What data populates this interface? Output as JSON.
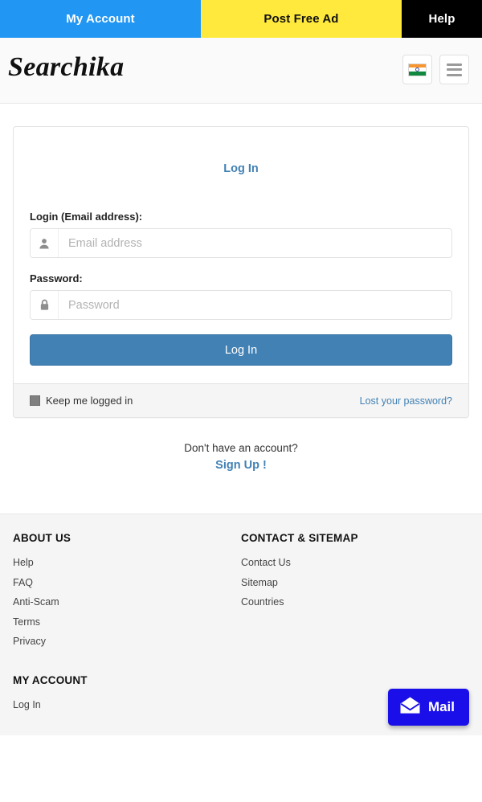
{
  "topnav": {
    "items": [
      {
        "label": "My Account",
        "bg": "#2196f3",
        "color": "#ffffff"
      },
      {
        "label": "Post Free Ad",
        "bg": "#ffe93d",
        "color": "#111111"
      },
      {
        "label": "Help",
        "bg": "#000000",
        "color": "#ffffff"
      }
    ]
  },
  "header": {
    "brand": "Searchika",
    "flag_icon": "india-flag-icon",
    "menu_icon": "hamburger-menu-icon"
  },
  "login_panel": {
    "heading": "Log In",
    "email": {
      "label": "Login (Email address):",
      "placeholder": "Email address",
      "value": "",
      "icon": "user-icon"
    },
    "password": {
      "label": "Password:",
      "placeholder": "Password",
      "value": "",
      "icon": "lock-icon"
    },
    "submit_label": "Log In",
    "keep_logged_in_label": "Keep me logged in",
    "keep_logged_in_checked": false,
    "lost_password_label": "Lost your password?"
  },
  "signup": {
    "question": "Don't have an account?",
    "link_label": "Sign Up !"
  },
  "footer": {
    "columns": [
      {
        "title": "ABOUT US",
        "links": [
          "Help",
          "FAQ",
          "Anti-Scam",
          "Terms",
          "Privacy"
        ],
        "title2": "MY ACCOUNT",
        "links2": [
          "Log In"
        ]
      },
      {
        "title": "CONTACT & SITEMAP",
        "links": [
          "Contact Us",
          "Sitemap",
          "Countries"
        ]
      }
    ]
  },
  "mail_widget": {
    "label": "Mail",
    "icon": "envelope-open-icon",
    "color": "#1a0fe8"
  },
  "colors": {
    "nav_blue": "#2196f3",
    "nav_yellow": "#ffe93d",
    "nav_black": "#000000",
    "primary_button": "#4281b4",
    "link": "#4281b4",
    "footer_bg": "#f5f5f5",
    "mail_blue": "#1a0fe8"
  }
}
